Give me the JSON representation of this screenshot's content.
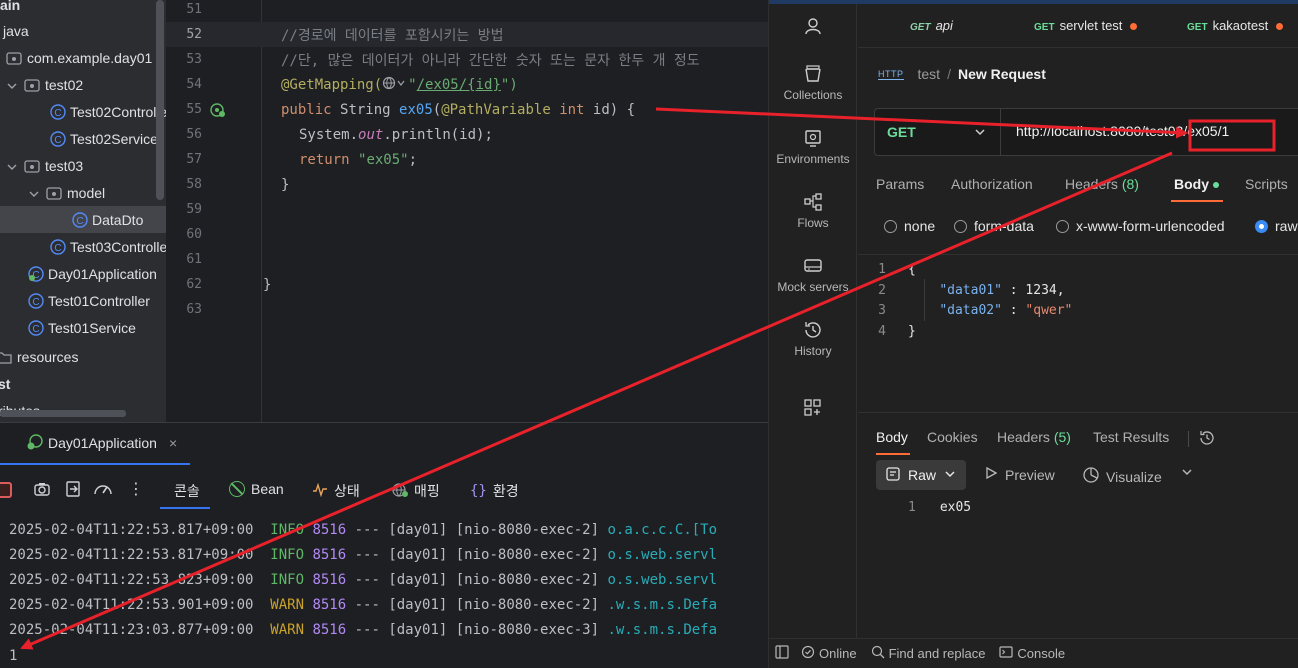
{
  "tree": {
    "items": [
      {
        "label": "ain",
        "kind": "folder-root"
      },
      {
        "label": "java",
        "kind": "folder"
      },
      {
        "label": "com.example.day01",
        "kind": "package"
      },
      {
        "label": "test02",
        "kind": "package"
      },
      {
        "label": "Test02Controlle",
        "kind": "class"
      },
      {
        "label": "Test02Service",
        "kind": "class"
      },
      {
        "label": "test03",
        "kind": "package"
      },
      {
        "label": "model",
        "kind": "package"
      },
      {
        "label": "DataDto",
        "kind": "class"
      },
      {
        "label": "Test03Controlle",
        "kind": "class"
      },
      {
        "label": "Day01Application",
        "kind": "app-class"
      },
      {
        "label": "Test01Controller",
        "kind": "class"
      },
      {
        "label": "Test01Service",
        "kind": "class"
      },
      {
        "label": "resources",
        "kind": "folder"
      },
      {
        "label": "st",
        "kind": "folder-root"
      },
      {
        "label": "ributes",
        "kind": "file"
      }
    ]
  },
  "editor": {
    "line_numbers": [
      "51",
      "52",
      "53",
      "54",
      "55",
      "56",
      "57",
      "58",
      "59",
      "60",
      "61",
      "62",
      "63"
    ],
    "comment1": "//경로에 데이터를 포함시키는 방법",
    "comment2": "//단, 많은 데이터가 아니라 간단한 숫자 또는 문자 한두 개 정도",
    "anno": "@GetMapping(",
    "anno_path_open": "\"",
    "anno_path": "/ex05/{id}",
    "anno_path_close": "\")",
    "l55_public": "public ",
    "l55_type": "String ",
    "l55_fn": "ex05",
    "l55_paren": "(",
    "l55_pv": "@PathVariable ",
    "l55_int": "int ",
    "l55_rest": "id) {",
    "l56_a": "System.",
    "l56_out": "out",
    "l56_b": ".println(id);",
    "l57_ret": "return ",
    "l57_str": "\"ex05\"",
    "l57_semi": ";",
    "l58": "}",
    "l62": "}"
  },
  "run": {
    "tab_label": "Day01Application",
    "tab_close": "×",
    "toolbar": {
      "console": "콘솔",
      "bean": "Bean",
      "status": "상태",
      "mapping": "매핑",
      "env": "환경"
    },
    "logs": [
      {
        "ts": "2025-02-04T11:22:53.817+09:00",
        "level": "INFO",
        "pid": "8516",
        "rest": " --- [day01] [nio-8080-exec-2] ",
        "logger": "o.a.c.c.C.[To"
      },
      {
        "ts": "2025-02-04T11:22:53.817+09:00",
        "level": "INFO",
        "pid": "8516",
        "rest": " --- [day01] [nio-8080-exec-2] ",
        "logger": "o.s.web.servl"
      },
      {
        "ts": "2025-02-04T11:22:53.823+09:00",
        "level": "INFO",
        "pid": "8516",
        "rest": " --- [day01] [nio-8080-exec-2] ",
        "logger": "o.s.web.servl"
      },
      {
        "ts": "2025-02-04T11:22:53.901+09:00",
        "level": "WARN",
        "pid": "8516",
        "rest": " --- [day01] [nio-8080-exec-2] ",
        "logger": ".w.s.m.s.Defa"
      },
      {
        "ts": "2025-02-04T11:23:03.877+09:00",
        "level": "WARN",
        "pid": "8516",
        "rest": " --- [day01] [nio-8080-exec-3] ",
        "logger": ".w.s.m.s.Defa"
      }
    ],
    "output": "1"
  },
  "postman": {
    "sidebar": [
      "Collections",
      "Environments",
      "Flows",
      "Mock servers",
      "History"
    ],
    "tabs": [
      {
        "method": "GET",
        "name": "api",
        "dirty": false
      },
      {
        "method": "GET",
        "name": "servlet test",
        "dirty": true
      },
      {
        "method": "GET",
        "name": "kakaotest",
        "dirty": true
      }
    ],
    "breadcrumb": {
      "icon": "HTTP",
      "parent": "test",
      "sep": "/",
      "current": "New Request"
    },
    "method": "GET",
    "url": "http://localhost:8080/test03/ex05/1",
    "req_tabs": {
      "params": "Params",
      "auth": "Authorization",
      "headers": "Headers",
      "headers_count": "(8)",
      "body": "Body",
      "scripts": "Scripts"
    },
    "body_types": [
      "none",
      "form-data",
      "x-www-form-urlencoded",
      "raw"
    ],
    "body_lines": [
      {
        "n": "1",
        "text": "{"
      },
      {
        "n": "2",
        "key": "\"data01\"",
        "sep": " : ",
        "val": "1234",
        "end": ","
      },
      {
        "n": "3",
        "key": "\"data02\"",
        "sep": " : ",
        "val": "\"qwer\"",
        "end": ""
      },
      {
        "n": "4",
        "text": "}"
      }
    ],
    "resp_tabs": {
      "body": "Body",
      "cookies": "Cookies",
      "headers": "Headers",
      "headers_count": "(5)",
      "tests": "Test Results"
    },
    "resp_view": {
      "raw": "Raw",
      "preview": "Preview",
      "visualize": "Visualize"
    },
    "resp_line": {
      "n": "1",
      "text": "ex05"
    },
    "status": {
      "online": "Online",
      "find": "Find and replace",
      "console": "Console"
    }
  },
  "colors": {
    "annotation": "#e8212b",
    "accent": "#3574f0",
    "postman_green": "#6bdd9a",
    "postman_orange": "#ff6c37"
  }
}
